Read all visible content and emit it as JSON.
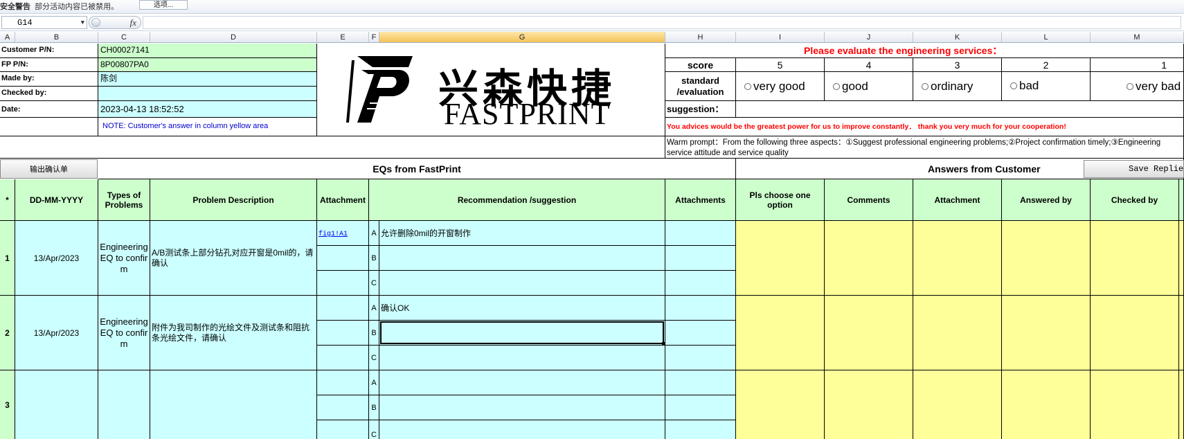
{
  "security_bar": {
    "warning_label": "安全警告",
    "warning_text": "部分活动内容已被禁用。",
    "options_button": "选项..."
  },
  "formula_bar": {
    "name_box": "G14",
    "fx_label": "fx",
    "formula": ""
  },
  "columns": [
    "A",
    "B",
    "C",
    "D",
    "E",
    "F",
    "G",
    "H",
    "I",
    "J",
    "K",
    "L",
    "M"
  ],
  "header_info": {
    "customer_pn_label": "Customer P/N:",
    "customer_pn": "CH00027141",
    "fp_pn_label": "FP P/N:",
    "fp_pn": "8P00807PA0",
    "made_by_label": "Made by:",
    "made_by": "陈剑",
    "checked_by_label": "Checked by:",
    "checked_by": "",
    "date_label": "Date:",
    "date": "2023-04-13 18:52:52",
    "note": "NOTE: Customer's  answer in column yellow area"
  },
  "logo": {
    "chinese": "兴森快捷",
    "english": "FASTPRINT"
  },
  "evaluation": {
    "title": "Please evaluate the engineering services：",
    "score_label": "score",
    "standard_label": "standard /evaluation",
    "suggestion_label": "suggestion：",
    "options": [
      {
        "score": "5",
        "label": "very good"
      },
      {
        "score": "4",
        "label": "good"
      },
      {
        "score": "3",
        "label": "ordinary"
      },
      {
        "score": "2",
        "label": "bad"
      },
      {
        "score": "1",
        "label": "very bad"
      }
    ],
    "advice": "You advices would be the greatest power for us to improve constantly．  thank you very much for your cooperation!",
    "warm_prompt": "Warm prompt：From the following three aspects：①Suggest professional engineering problems;②Project confirmation timely;③Engineering service attitude and service quality"
  },
  "buttons": {
    "export": "输出确认单",
    "save": "Save Replies"
  },
  "sections": {
    "eqs": "EQs from FastPrint",
    "answers": "Answers from Customer"
  },
  "table_headers": {
    "star": "*",
    "date": "DD-MM-YYYY",
    "types": "Types of Problems",
    "problem": "Problem Description",
    "attachment": "Attachment",
    "recommendation": "Recommendation /suggestion",
    "attachments": "Attachments",
    "choose": "Pls choose one option",
    "comments": "Comments",
    "answer_attachment": "Attachment",
    "answered_by": "Answered by",
    "checked_by": "Checked by"
  },
  "rows": [
    {
      "no": "1",
      "date": "13/Apr/2023",
      "type": "Engineering EQ to confirm",
      "problem": "A/B测试条上部分钻孔对应开窗是0mil的，请确认",
      "attachment": "fig1!A1",
      "options": [
        {
          "letter": "A",
          "text": "允许删除0mil的开窗制作"
        },
        {
          "letter": "B",
          "text": ""
        },
        {
          "letter": "C",
          "text": ""
        }
      ]
    },
    {
      "no": "2",
      "date": "13/Apr/2023",
      "type": "Engineering EQ to confirm",
      "problem": "附件为我司制作的光绘文件及测试条和阻抗条光绘文件，请确认",
      "attachment": "",
      "options": [
        {
          "letter": "A",
          "text": "确认OK"
        },
        {
          "letter": "B",
          "text": ""
        },
        {
          "letter": "C",
          "text": ""
        }
      ]
    },
    {
      "no": "3",
      "date": "",
      "type": "",
      "problem": "",
      "attachment": "",
      "options": [
        {
          "letter": "A",
          "text": ""
        },
        {
          "letter": "B",
          "text": ""
        },
        {
          "letter": "C",
          "text": ""
        }
      ]
    }
  ],
  "colors": {
    "green": "#ccffcc",
    "cyan": "#ccffff",
    "yellow": "#ffff99",
    "red": "#ff0000",
    "blue_note": "#0000cc"
  }
}
